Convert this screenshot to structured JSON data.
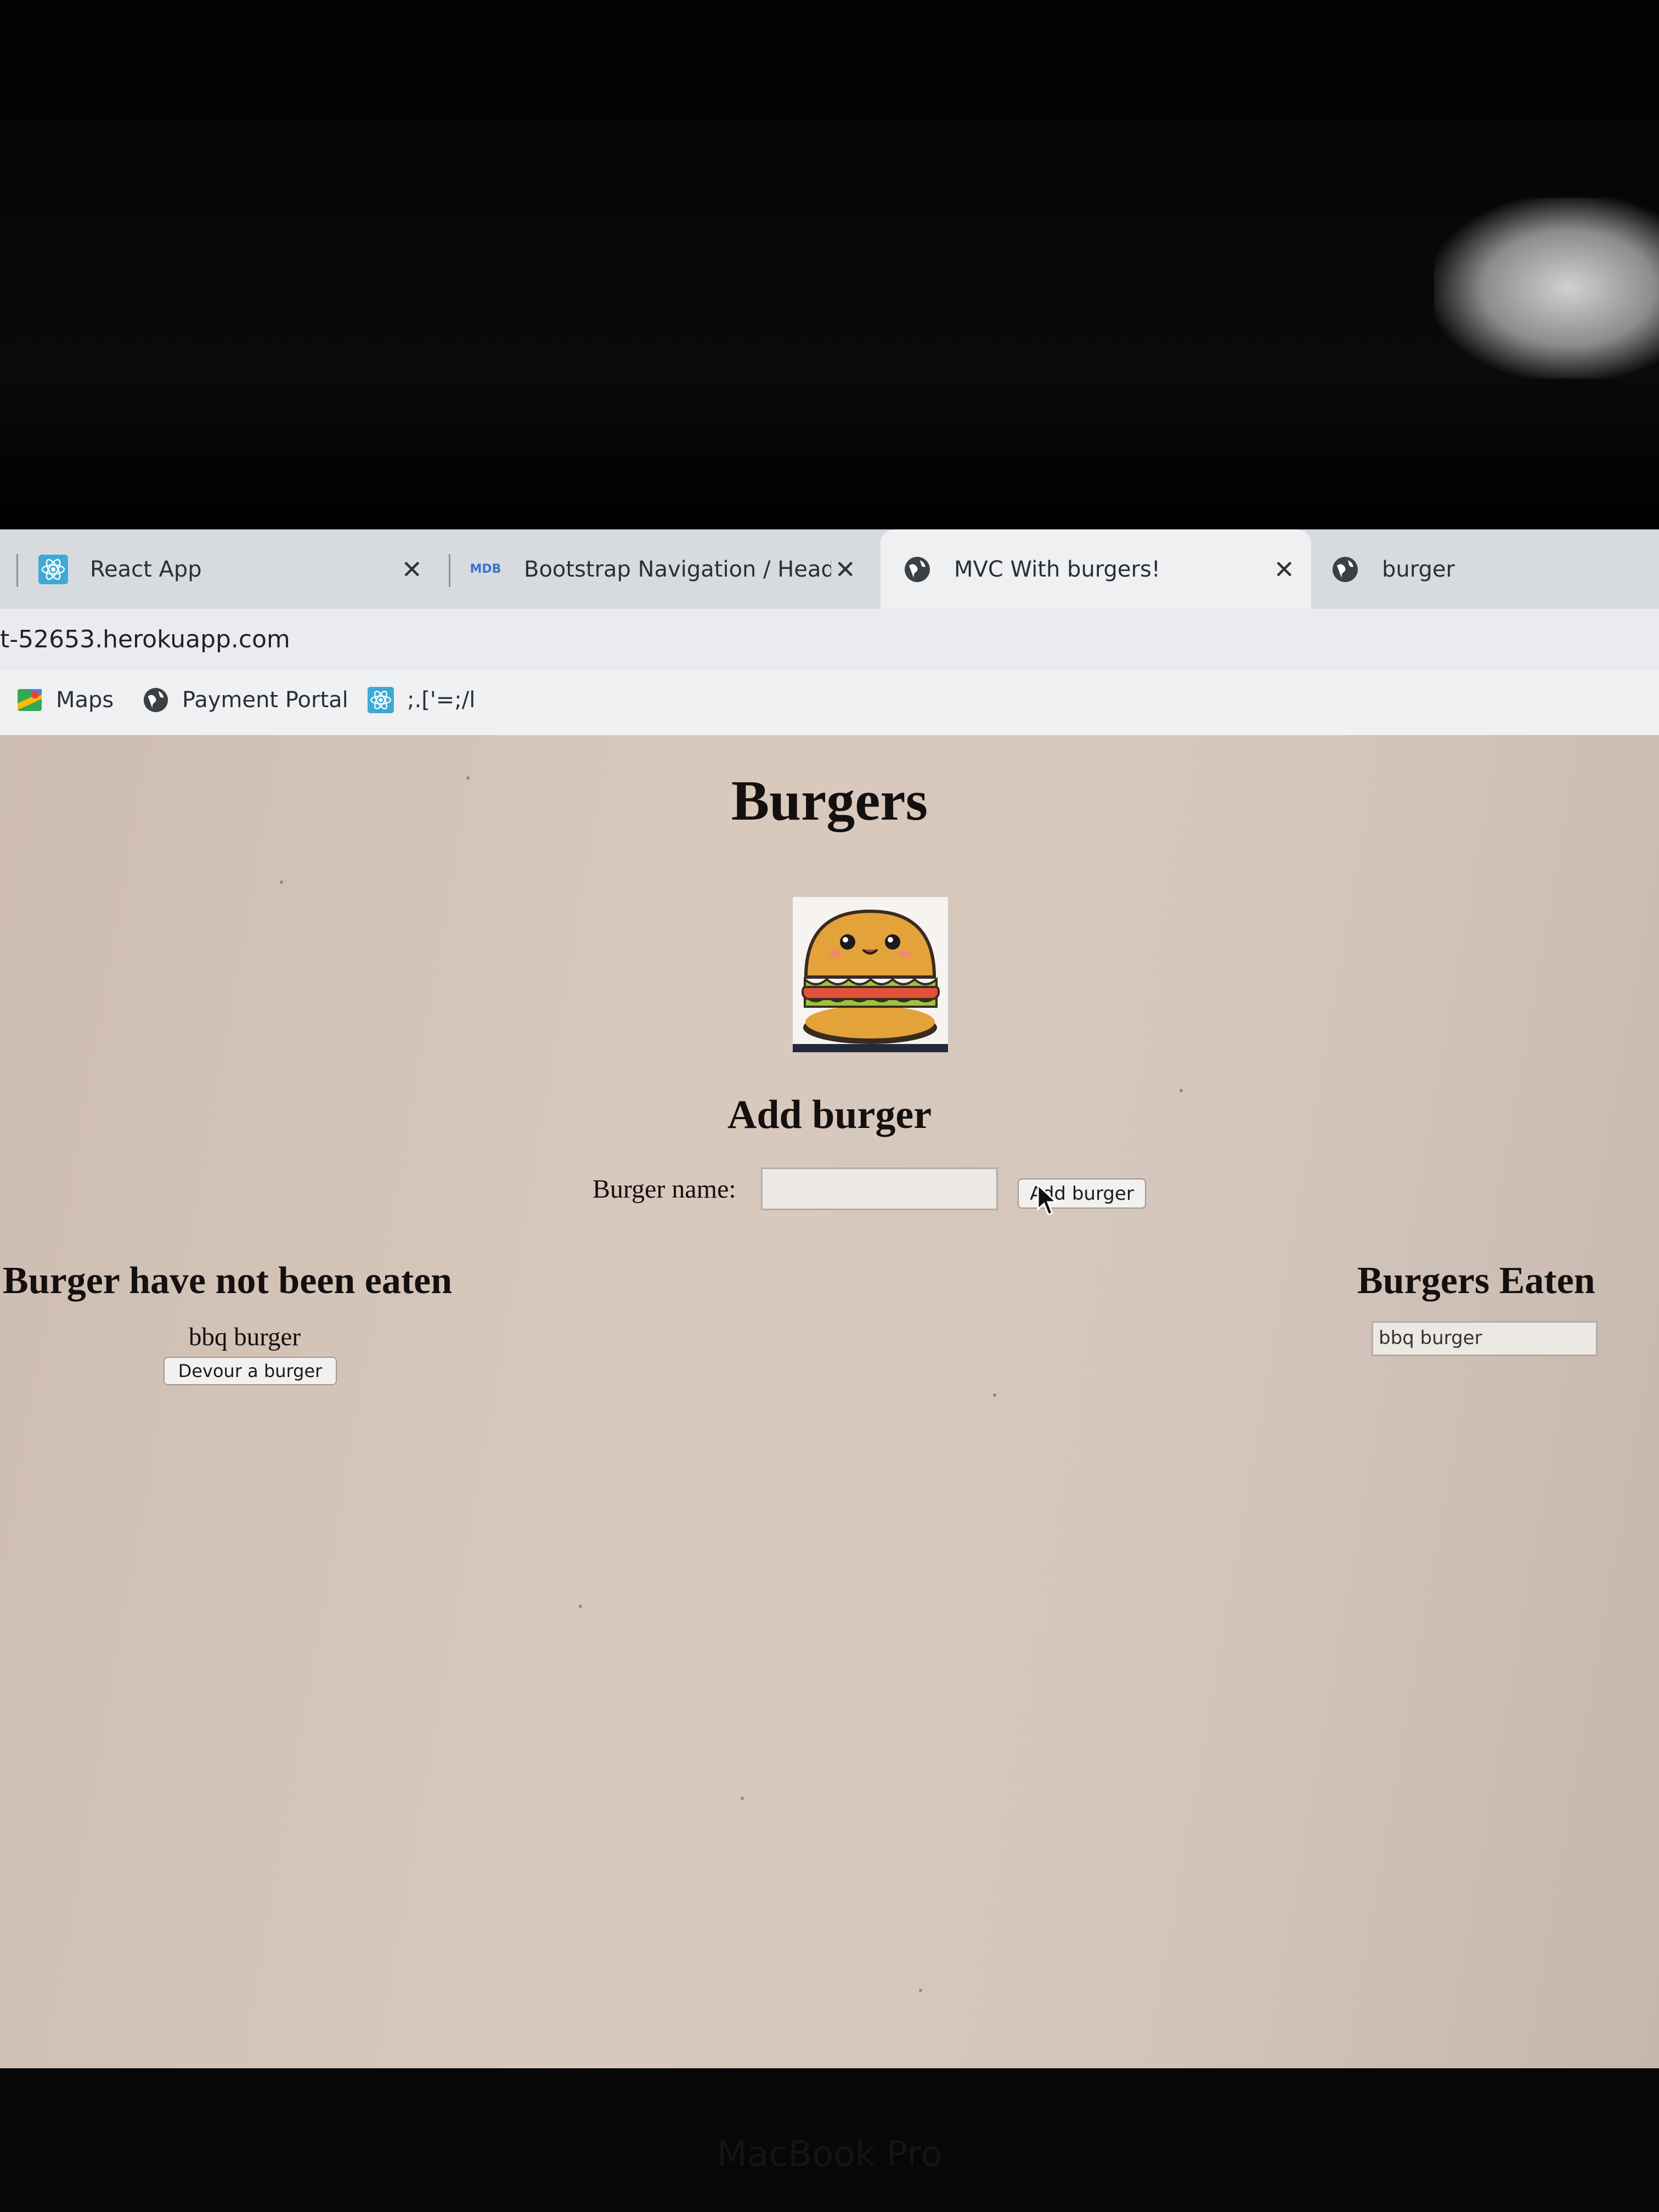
{
  "browser": {
    "tabs": [
      {
        "label": "React App",
        "icon": "react-icon",
        "close": "✕"
      },
      {
        "label": "Bootstrap Navigation / Header",
        "icon": "mdb-icon",
        "icon_text": "MDB",
        "close": "✕"
      },
      {
        "label": "MVC With burgers!",
        "icon": "globe-icon",
        "close": "✕",
        "active": true
      },
      {
        "label": "burger",
        "icon": "globe-icon"
      }
    ],
    "url": "t-52653.herokuapp.com",
    "bookmarks": [
      {
        "label": "Maps",
        "icon": "maps-icon"
      },
      {
        "label": "Payment Portal",
        "icon": "globe-icon"
      },
      {
        "label": ";.['=;/l",
        "icon": "react-icon"
      }
    ]
  },
  "page": {
    "title": "Burgers",
    "image": "burger-cartoon-image",
    "add_heading": "Add burger",
    "form": {
      "label": "Burger name:",
      "input_value": "",
      "button": "Add burger"
    },
    "not_eaten": {
      "heading": "Burger have not been eaten",
      "items": [
        {
          "name": "bbq burger",
          "button": "Devour a burger"
        }
      ]
    },
    "eaten": {
      "heading": "Burgers Eaten",
      "items": [
        "bbq burger"
      ]
    }
  },
  "device_label": "MacBook Pro",
  "colors": {
    "page_bg": "#d4c4b8",
    "tab_strip": "#d7dbe0",
    "active_tab": "#eef0f2",
    "react_blue": "#3fa9d6"
  }
}
